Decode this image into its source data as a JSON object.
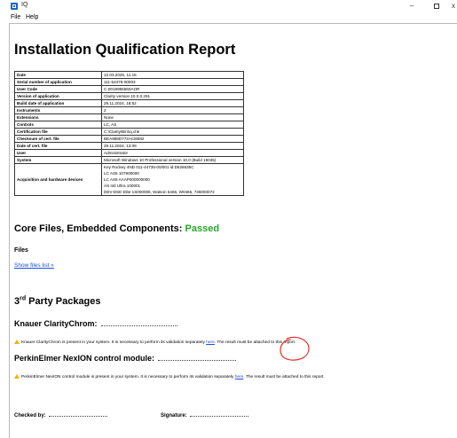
{
  "window": {
    "title": "IQ",
    "minimize": "–",
    "close": "x"
  },
  "menu": {
    "file": "File",
    "help": "Help"
  },
  "report": {
    "title": "Installation Qualification Report",
    "info_rows": [
      {
        "key": "Date",
        "value": "12.03.2025, 11:15"
      },
      {
        "key": "Serial number of application",
        "value": "111-54476-00003"
      },
      {
        "key": "User Code",
        "value": "C-0019955560AOR"
      },
      {
        "key": "Version of application",
        "value": "Clarity version 10.0.0.291"
      },
      {
        "key": "Build date of application",
        "value": "29.11.2024, 18:52"
      },
      {
        "key": "Instruments",
        "value": "2"
      },
      {
        "key": "Extensions",
        "value": "None"
      },
      {
        "key": "Controls",
        "value": "LC, AS"
      },
      {
        "key": "Certification file",
        "value": "C:\\Clarity\\Bin\\iq.chk"
      },
      {
        "key": "Checksum of cert. file",
        "value": "BEA988D772ACEB82"
      },
      {
        "key": "Date of cert. file",
        "value": "29.11.2024, 13:09"
      },
      {
        "key": "User",
        "value": "Administrator"
      },
      {
        "key": "System",
        "value": "Microsoft Windows 10 Professional version 10.0 (Build 19045)"
      }
    ],
    "acq_row": {
      "key": "Acquisition and hardware devices",
      "lines": [
        "Key Rockey 4ND 011-44736-00/001 id:D626635C",
        "LC AS5 107900000",
        "LC AS5 AAAP000000000",
        "AS Intl Ultra 100001",
        "DEV-DSE Elite 1S000006, Watson 5466, W0465, 736000072"
      ]
    },
    "core_heading": "Core Files, Embedded Components:",
    "core_status": "Passed",
    "files_heading": "Files",
    "show_files_link": "Show files list »",
    "third_party_prefix": "3",
    "third_party_sup": "rd",
    "third_party_suffix": " Party Packages",
    "knauer_heading": "Knauer ClarityChrom:",
    "knauer_warning_pre": "Knauer ClarityChrom is present in your system. It is necessary to perform its validation separately ",
    "knauer_link": "here",
    "knauer_warning_post": ". The result must be attached to this report.",
    "perkin_heading": "PerkinElmer NexION control module:",
    "perkin_warning_pre": "PerkinElmer NexION control module is present in your system. It is necessary to perform its validation separately ",
    "perkin_link": "here",
    "perkin_warning_post": ". The result must be attached to this report.",
    "checked_by": "Checked by:",
    "signature": "Signature:"
  },
  "colors": {
    "passed": "#2aa52a",
    "link": "#1a4fd8",
    "annotation": "#e0302a",
    "warning": "#f2b400"
  }
}
